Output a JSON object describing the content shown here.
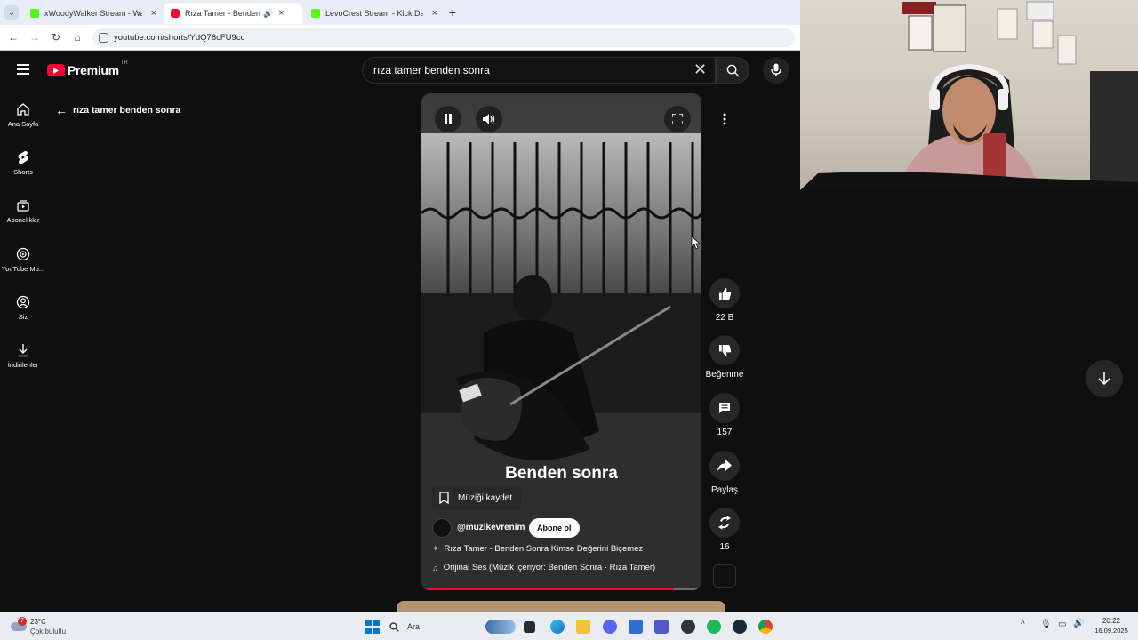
{
  "browser": {
    "tabs": [
      {
        "title": "xWoodyWalker Stream - Watch",
        "fav_color": "#53fc18",
        "active": false
      },
      {
        "title": "Rıza Tamer - Benden Sc",
        "fav_color": "#ff0033",
        "active": true
      },
      {
        "title": "LevoCrest Stream - Kick Dashbo",
        "fav_color": "#53fc18",
        "active": false
      }
    ],
    "url": "youtube.com/shorts/YdQ78cFU9cc"
  },
  "youtube": {
    "logo_text": "Premium",
    "logo_region": "TR",
    "search_value": "rıza tamer benden sonra",
    "back_title": "rıza tamer benden sonra",
    "sidebar": [
      {
        "label": "Ana Sayfa",
        "icon": "home-icon"
      },
      {
        "label": "Shorts",
        "icon": "shorts-icon"
      },
      {
        "label": "Abonelikler",
        "icon": "subscriptions-icon"
      },
      {
        "label": "YouTube Mu...",
        "icon": "youtube-music-icon"
      },
      {
        "label": "Siz",
        "icon": "account-icon"
      },
      {
        "label": "İndirilenler",
        "icon": "download-icon"
      }
    ],
    "short": {
      "overlay_title": "Benden sonra",
      "save_music": "Müziği kaydet",
      "channel": "@muzikevrenim",
      "subscribe": "Abone ol",
      "title_line": "Rıza Tamer - Benden Sonra Kimse Değerini Biçemez",
      "audio_line": "Orijinal Ses (Müzik içeriyor: Benden Sonra · Rıza Tamer)",
      "progress": 0.9
    },
    "actions": {
      "likes": "22 B",
      "dislike": "Beğenme",
      "comments": "157",
      "share": "Paylaş",
      "remix": "16"
    }
  },
  "taskbar": {
    "weather_temp": "23°C",
    "weather_desc": "Çok bulutlu",
    "weather_badge": "7",
    "search_label": "Ara",
    "time": "20:22",
    "date": "16.09.2025"
  }
}
